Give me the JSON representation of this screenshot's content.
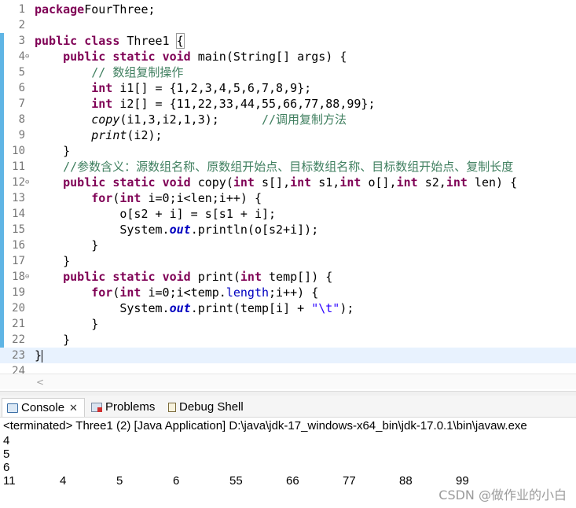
{
  "editor": {
    "current_line": 23,
    "lines": [
      {
        "n": "1",
        "fold": "",
        "tokens": [
          [
            "k",
            "package"
          ],
          [
            "",
            "FourThree;"
          ]
        ]
      },
      {
        "n": "2",
        "fold": "",
        "tokens": []
      },
      {
        "n": "3",
        "fold": "",
        "tokens": [
          [
            "k",
            "public"
          ],
          [
            "",
            " "
          ],
          [
            "k",
            "class"
          ],
          [
            "",
            " Three1 "
          ],
          [
            "brk",
            "{"
          ]
        ]
      },
      {
        "n": "4",
        "fold": "⊖",
        "tokens": [
          [
            "",
            "    "
          ],
          [
            "k",
            "public"
          ],
          [
            "",
            " "
          ],
          [
            "k",
            "static"
          ],
          [
            "",
            " "
          ],
          [
            "k",
            "void"
          ],
          [
            "",
            " main(String[] args) {"
          ]
        ]
      },
      {
        "n": "5",
        "fold": "",
        "tokens": [
          [
            "",
            "        "
          ],
          [
            "c",
            "// 数组复制操作"
          ]
        ]
      },
      {
        "n": "6",
        "fold": "",
        "tokens": [
          [
            "",
            "        "
          ],
          [
            "k",
            "int"
          ],
          [
            "",
            " i1[] = {1,2,3,4,5,6,7,8,9};"
          ]
        ]
      },
      {
        "n": "7",
        "fold": "",
        "tokens": [
          [
            "",
            "        "
          ],
          [
            "k",
            "int"
          ],
          [
            "",
            " i2[] = {11,22,33,44,55,66,77,88,99};"
          ]
        ]
      },
      {
        "n": "8",
        "fold": "",
        "tokens": [
          [
            "",
            "        "
          ],
          [
            "m",
            "copy"
          ],
          [
            "",
            "(i1,3,i2,1,3);      "
          ],
          [
            "c",
            "//调用复制方法"
          ]
        ]
      },
      {
        "n": "9",
        "fold": "",
        "tokens": [
          [
            "",
            "        "
          ],
          [
            "m",
            "print"
          ],
          [
            "",
            "(i2);"
          ]
        ]
      },
      {
        "n": "10",
        "fold": "",
        "tokens": [
          [
            "",
            "    }"
          ]
        ]
      },
      {
        "n": "11",
        "fold": "",
        "tokens": [
          [
            "",
            "    "
          ],
          [
            "c",
            "//参数含义：源数组名称、原数组开始点、目标数组名称、目标数组开始点、复制长度"
          ]
        ]
      },
      {
        "n": "12",
        "fold": "⊖",
        "tokens": [
          [
            "",
            "    "
          ],
          [
            "k",
            "public"
          ],
          [
            "",
            " "
          ],
          [
            "k",
            "static"
          ],
          [
            "",
            " "
          ],
          [
            "k",
            "void"
          ],
          [
            "",
            " copy("
          ],
          [
            "k",
            "int"
          ],
          [
            "",
            " s[],"
          ],
          [
            "k",
            "int"
          ],
          [
            "",
            " s1,"
          ],
          [
            "k",
            "int"
          ],
          [
            "",
            " o[],"
          ],
          [
            "k",
            "int"
          ],
          [
            "",
            " s2,"
          ],
          [
            "k",
            "int"
          ],
          [
            "",
            " len) {"
          ]
        ]
      },
      {
        "n": "13",
        "fold": "",
        "tokens": [
          [
            "",
            "        "
          ],
          [
            "k",
            "for"
          ],
          [
            "",
            "("
          ],
          [
            "k",
            "int"
          ],
          [
            "",
            " i=0;i<len;i++) {"
          ]
        ]
      },
      {
        "n": "14",
        "fold": "",
        "tokens": [
          [
            "",
            "            o[s2 + i] = s[s1 + i];"
          ]
        ]
      },
      {
        "n": "15",
        "fold": "",
        "tokens": [
          [
            "",
            "            System."
          ],
          [
            "f",
            "out"
          ],
          [
            "",
            ".println(o[s2+i]);"
          ]
        ]
      },
      {
        "n": "16",
        "fold": "",
        "tokens": [
          [
            "",
            "        }"
          ]
        ]
      },
      {
        "n": "17",
        "fold": "",
        "tokens": [
          [
            "",
            "    }"
          ]
        ]
      },
      {
        "n": "18",
        "fold": "⊖",
        "tokens": [
          [
            "",
            "    "
          ],
          [
            "k",
            "public"
          ],
          [
            "",
            " "
          ],
          [
            "k",
            "static"
          ],
          [
            "",
            " "
          ],
          [
            "k",
            "void"
          ],
          [
            "",
            " print("
          ],
          [
            "k",
            "int"
          ],
          [
            "",
            " temp[]) {"
          ]
        ]
      },
      {
        "n": "19",
        "fold": "",
        "tokens": [
          [
            "",
            "        "
          ],
          [
            "k",
            "for"
          ],
          [
            "",
            "("
          ],
          [
            "k",
            "int"
          ],
          [
            "",
            " i=0;i<temp."
          ],
          [
            "fi",
            "length"
          ],
          [
            "",
            ";i++) {"
          ]
        ]
      },
      {
        "n": "20",
        "fold": "",
        "tokens": [
          [
            "",
            "            System."
          ],
          [
            "f",
            "out"
          ],
          [
            "",
            ".print(temp[i] + "
          ],
          [
            "s",
            "\"\\t\""
          ],
          [
            "",
            ");"
          ]
        ]
      },
      {
        "n": "21",
        "fold": "",
        "tokens": [
          [
            "",
            "        }"
          ]
        ]
      },
      {
        "n": "22",
        "fold": "",
        "tokens": [
          [
            "",
            "    }"
          ]
        ]
      },
      {
        "n": "23",
        "fold": "",
        "tokens": [
          [
            "",
            "}"
          ],
          [
            "caret",
            ""
          ]
        ]
      },
      {
        "n": "24",
        "fold": "",
        "tokens": []
      }
    ],
    "hscroll_arrow": "<"
  },
  "console": {
    "tabs": [
      {
        "label": "Console",
        "icon": "console-icon",
        "active": true,
        "close": "✕"
      },
      {
        "label": "Problems",
        "icon": "problems-icon",
        "active": false
      },
      {
        "label": "Debug Shell",
        "icon": "debug-shell-icon",
        "active": false
      }
    ],
    "status": "<terminated> Three1 (2) [Java Application] D:\\java\\jdk-17_windows-x64_bin\\jdk-17.0.1\\bin\\javaw.exe",
    "output_lines": [
      "4",
      "5",
      "6"
    ],
    "output_row": [
      "11",
      "4",
      "5",
      "6",
      "55",
      "66",
      "77",
      "88",
      "99"
    ]
  },
  "watermark": "CSDN @做作业的小白"
}
